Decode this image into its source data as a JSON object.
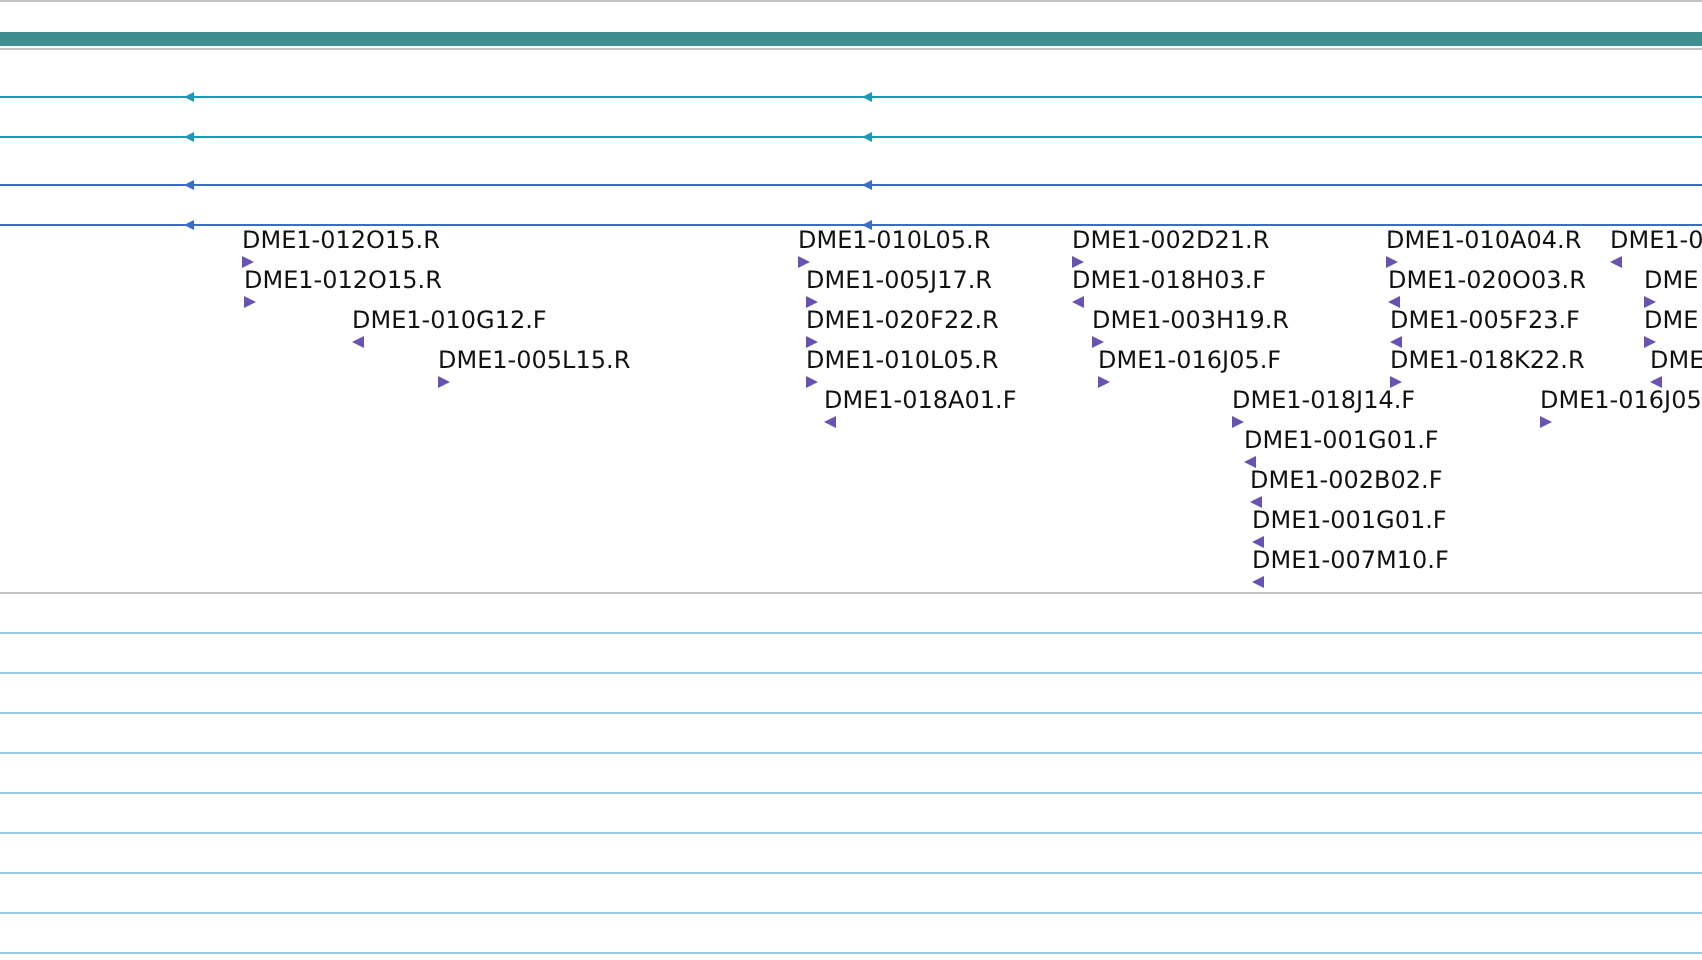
{
  "top_tracks": [
    {
      "color": "#1a9bb5",
      "kind": "reverse"
    },
    {
      "color": "#1a9bb5",
      "kind": "reverse"
    },
    {
      "color": "#3a6cc8",
      "kind": "reverse"
    },
    {
      "color": "#3a6cc8",
      "kind": "reverse"
    }
  ],
  "reads": [
    {
      "label": "DME1-012O15.R",
      "kind": "forward"
    },
    {
      "label": "DME1-012O15.R",
      "kind": "forward"
    },
    {
      "label": "DME1-010G12.F",
      "kind": "reverse"
    },
    {
      "label": "DME1-005L15.R",
      "kind": "forward"
    },
    {
      "label": "DME1-010L05.R",
      "kind": "forward"
    },
    {
      "label": "DME1-005J17.R",
      "kind": "forward"
    },
    {
      "label": "DME1-020F22.R",
      "kind": "forward"
    },
    {
      "label": "DME1-010L05.R",
      "kind": "forward"
    },
    {
      "label": "DME1-018A01.F",
      "kind": "reverse"
    },
    {
      "label": "DME1-002D21.R",
      "kind": "forward"
    },
    {
      "label": "DME1-018H03.F",
      "kind": "reverse"
    },
    {
      "label": "DME1-003H19.R",
      "kind": "forward"
    },
    {
      "label": "DME1-016J05.F",
      "kind": "forward"
    },
    {
      "label": "DME1-018J14.F",
      "kind": "forward"
    },
    {
      "label": "DME1-001G01.F",
      "kind": "reverse"
    },
    {
      "label": "DME1-002B02.F",
      "kind": "reverse"
    },
    {
      "label": "DME1-001G01.F",
      "kind": "reverse"
    },
    {
      "label": "DME1-007M10.F",
      "kind": "reverse"
    },
    {
      "label": "DME1-010A04.R",
      "kind": "forward"
    },
    {
      "label": "DME1-020O03.R",
      "kind": "reverse"
    },
    {
      "label": "DME1-005F23.F",
      "kind": "reverse"
    },
    {
      "label": "DME1-018K22.R",
      "kind": "forward"
    },
    {
      "label": "DME1-0",
      "kind": "reverse"
    },
    {
      "label": "DME",
      "kind": "forward"
    },
    {
      "label": "DME",
      "kind": "forward"
    },
    {
      "label": "DME",
      "kind": "reverse"
    },
    {
      "label": "DME1-016J05",
      "kind": "forward"
    }
  ]
}
